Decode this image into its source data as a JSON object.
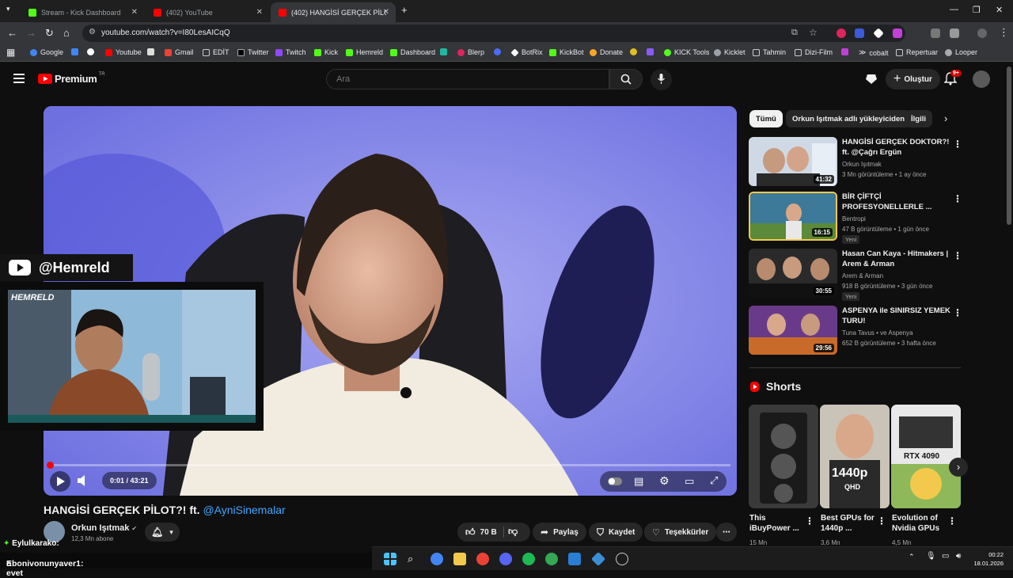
{
  "browser": {
    "tabs": [
      {
        "title": "Stream - Kick Dashboard",
        "favicon_color": "#53fc18"
      },
      {
        "title": "(402) YouTube",
        "favicon_color": "#ff0000"
      },
      {
        "title": "(402) HANGİSİ GERÇEK PİLOT?",
        "favicon_color": "#ff0000"
      }
    ],
    "new_tab": "+",
    "url": "youtube.com/watch?v=I80LesAICqQ",
    "bookmarks": [
      "Google",
      "Youtube",
      "Gmail",
      "EDİT",
      "Twitter",
      "Twitch",
      "Kick",
      "Hemreld",
      "Dashboard",
      "Blerp",
      "BotRix",
      "KickBot",
      "Donate",
      "KICK Tools",
      "Kicklet",
      "Tahmin",
      "Dizi-Film",
      "cobalt",
      "Repertuar",
      "Looper"
    ]
  },
  "youtube_header": {
    "logo": "Premium",
    "logo_sup": "TR",
    "search_placeholder": "Ara",
    "create_label": "Oluştur",
    "notif_count": "9+"
  },
  "player": {
    "time": "0:01 / 43:21",
    "progress_fraction": 0.0004
  },
  "overlay": {
    "handle": "@Hemreld",
    "cam_logo": "HEMRELD"
  },
  "video": {
    "title": "HANGİSİ GERÇEK PİLOT?! ft.",
    "title_link": "@AyniSinemalar",
    "channel": "Orkun Işıtmak",
    "subs": "12,3 Mn abone",
    "likes": "70 B",
    "share": "Paylaş",
    "save": "Kaydet",
    "thanks": "Teşekkürler"
  },
  "chips": [
    "Tümü",
    "Orkun Işıtmak adlı yükleyiciden",
    "İlgili"
  ],
  "related": [
    {
      "title": "HANGİSİ GERÇEK DOKTOR?! ft. @Çağrı Ergün",
      "channel": "Orkun Işıtmak",
      "meta": "3 Mn görüntüleme • 1 ay önce",
      "duration": "41:32",
      "badge": ""
    },
    {
      "title": "BİR ÇİFTÇİ PROFESYONELLERLE ...",
      "channel": "Bentropi",
      "meta": "47 B görüntüleme • 1 gün önce",
      "duration": "16:15",
      "badge": "Yeni"
    },
    {
      "title": "Hasan Can Kaya - Hitmakers | Arem & Arman",
      "channel": "Arem & Arman",
      "meta": "918 B görüntüleme • 3 gün önce",
      "duration": "30:55",
      "badge": "Yeni"
    },
    {
      "title": "ASPENYA ile SINIRSIZ YEMEK TURU!",
      "channel": "Tuna Tavus • ve Aspenya",
      "meta": "652 B görüntüleme • 3 hafta önce",
      "duration": "29:56",
      "badge": ""
    }
  ],
  "shorts": {
    "heading": "Shorts",
    "items": [
      {
        "title": "This iBuyPower ...",
        "views": "15 Mn"
      },
      {
        "title": "Best GPUs for 1440p ...",
        "views": "3,6 Mn"
      },
      {
        "title": "Evolution of Nvidia GPUs",
        "views": "4,5 Mn"
      }
    ],
    "overlay_text": [
      "1440p",
      "QHD",
      "RTX 4090"
    ]
  },
  "chat": [
    {
      "user": "Eylulkarako:",
      "message": ""
    },
    {
      "user": "Ebonivonunyaver1:",
      "message": "o evet"
    }
  ],
  "taskbar": {
    "time": "00:22",
    "date": "18.01.2026"
  }
}
